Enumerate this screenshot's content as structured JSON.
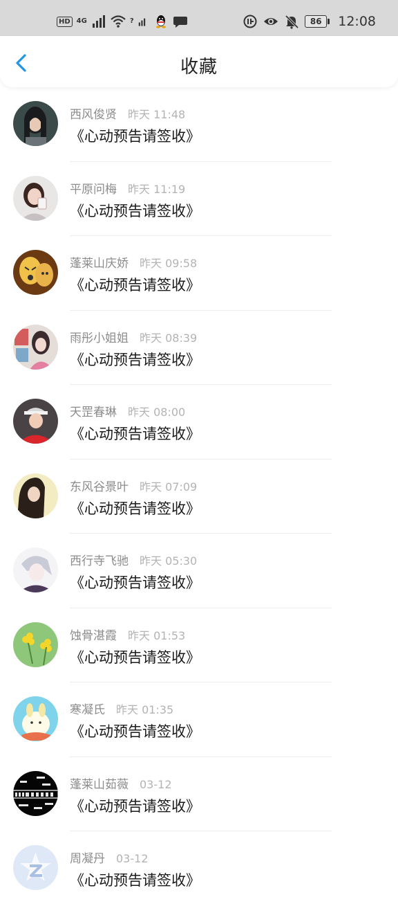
{
  "status_bar": {
    "hd_badge": "HD",
    "network_type": "4G",
    "signal_2_label": "?",
    "battery_level": "86",
    "time": "12:08",
    "icons": [
      "hd-icon",
      "signal-icon",
      "wifi-icon",
      "signal-icon",
      "qq-icon",
      "chat-bubble-icon",
      "data-saver-icon",
      "eye-icon",
      "bell-muted-icon",
      "battery-icon"
    ]
  },
  "header": {
    "title": "收藏",
    "back_icon": "chevron-left-icon"
  },
  "colors": {
    "accent": "#2196e6",
    "name": "#8c8c8c",
    "time": "#b3b3b3",
    "text": "#1a1a1a"
  },
  "favorites": [
    {
      "name": "西风俊贤",
      "time": "昨天 11:48",
      "text": "《心动预告请签收》"
    },
    {
      "name": "平原问梅",
      "time": "昨天 11:19",
      "text": "《心动预告请签收》"
    },
    {
      "name": "蓬莱山庆娇",
      "time": "昨天 09:58",
      "text": "《心动预告请签收》"
    },
    {
      "name": "雨彤小姐姐",
      "time": "昨天 08:39",
      "text": "《心动预告请签收》"
    },
    {
      "name": "天罡春琳",
      "time": "昨天 08:00",
      "text": "《心动预告请签收》"
    },
    {
      "name": "东风谷景叶",
      "time": "昨天 07:09",
      "text": "《心动预告请签收》"
    },
    {
      "name": "西行寺飞驰",
      "time": "昨天 05:30",
      "text": "《心动预告请签收》"
    },
    {
      "name": "蚀骨湛霞",
      "time": "昨天 01:53",
      "text": "《心动预告请签收》"
    },
    {
      "name": "寒凝氏",
      "time": "昨天 01:35",
      "text": "《心动预告请签收》"
    },
    {
      "name": "蓬莱山茹薇",
      "time": "03-12",
      "text": "《心动预告请签收》"
    },
    {
      "name": "周凝丹",
      "time": "03-12",
      "text": "《心动预告请签收》"
    }
  ]
}
